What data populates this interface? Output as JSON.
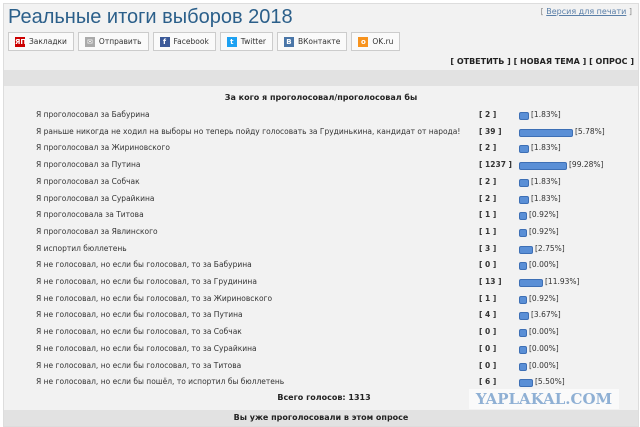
{
  "title": "Реальные итоги выборов 2018",
  "print_link": "Версия для печати",
  "share": [
    {
      "label": "Закладки",
      "icon": "yap-icon",
      "color": "#c00"
    },
    {
      "label": "Отправить",
      "icon": "mail-icon",
      "color": "#aaa"
    },
    {
      "label": "Facebook",
      "icon": "facebook-icon",
      "color": "#3b5998"
    },
    {
      "label": "Twitter",
      "icon": "twitter-icon",
      "color": "#1da1f2"
    },
    {
      "label": "ВКонтакте",
      "icon": "vk-icon",
      "color": "#4a76a8"
    },
    {
      "label": "OK.ru",
      "icon": "ok-icon",
      "color": "#f7931e"
    }
  ],
  "actions": {
    "reply": "ОТВЕТИТЬ",
    "new_topic": "НОВАЯ ТЕМА",
    "poll": "ОПРОС"
  },
  "poll": {
    "question": "За кого я проголосовал/проголосовал бы",
    "options": [
      {
        "text": "Я проголосовал за Бабурина",
        "votes": "2",
        "percent": "[1.83%]",
        "bar": 0.12
      },
      {
        "text": "Я раньше никогда не ходил на выборы но теперь пойду голосовать за Грудинькина, кандидат от народа!",
        "votes": "39",
        "percent": "[5.78%]",
        "bar": 1.0
      },
      {
        "text": "Я проголосовал за Жириновского",
        "votes": "2",
        "percent": "[1.83%]",
        "bar": 0.12
      },
      {
        "text": "Я проголосовал за Путина",
        "votes": "1237",
        "percent": "[99.28%]",
        "bar": 0.88
      },
      {
        "text": "Я проголосовал за Собчак",
        "votes": "2",
        "percent": "[1.83%]",
        "bar": 0.12
      },
      {
        "text": "Я проголосовал за Сурайкина",
        "votes": "2",
        "percent": "[1.83%]",
        "bar": 0.12
      },
      {
        "text": "Я проголосовала за Титова",
        "votes": "1",
        "percent": "[0.92%]",
        "bar": 0.08
      },
      {
        "text": "Я проголосовал за Явлинского",
        "votes": "1",
        "percent": "[0.92%]",
        "bar": 0.08
      },
      {
        "text": "Я испортил бюллетень",
        "votes": "3",
        "percent": "[2.75%]",
        "bar": 0.2
      },
      {
        "text": "Я не голосовал, но если бы голосовал, то за Бабурина",
        "votes": "0",
        "percent": "[0.00%]",
        "bar": 0.08
      },
      {
        "text": "Я не голосовал, но если бы голосовал, то за Грудинина",
        "votes": "13",
        "percent": "[11.93%]",
        "bar": 0.4
      },
      {
        "text": "Я не голосовал, но если бы голосовал, то за Жириновского",
        "votes": "1",
        "percent": "[0.92%]",
        "bar": 0.08
      },
      {
        "text": "Я не голосовал, но если бы голосовал, то за Путина",
        "votes": "4",
        "percent": "[3.67%]",
        "bar": 0.12
      },
      {
        "text": "Я не голосовал, но если бы голосовал, то за Собчак",
        "votes": "0",
        "percent": "[0.00%]",
        "bar": 0.08
      },
      {
        "text": "Я не голосовал, но если бы голосовал, то за Сурайкина",
        "votes": "0",
        "percent": "[0.00%]",
        "bar": 0.08
      },
      {
        "text": "Я не голосовал, но если бы голосовал, то за Титова",
        "votes": "0",
        "percent": "[0.00%]",
        "bar": 0.08
      },
      {
        "text": "Я не голосовал, но если бы пошёл, то испортил бы бюллетень",
        "votes": "6",
        "percent": "[5.50%]",
        "bar": 0.2
      }
    ],
    "total": "Всего голосов: 1313",
    "already_voted": "Вы уже проголосовали в этом опросе"
  },
  "watermark": "YAPLAKAL.COM"
}
